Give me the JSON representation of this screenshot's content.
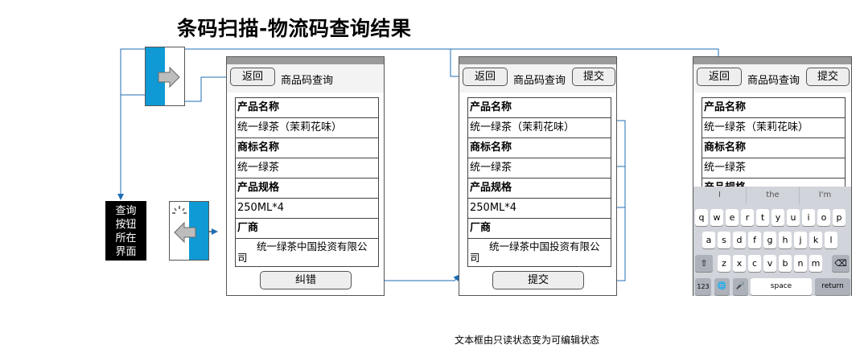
{
  "title": "条码扫描-物流码查询结果",
  "footnote": "文本框由只读状态变为可编辑状态",
  "caption_box": [
    "查询",
    "按钮",
    "所在",
    "界面"
  ],
  "phones": [
    {
      "back_label": "返回",
      "nav_title": "商品码查询",
      "submit_label": "",
      "fields": [
        {
          "label": "产品名称",
          "value": "统一绿茶（茉莉花味）"
        },
        {
          "label": "商标名称",
          "value": "统一绿茶"
        },
        {
          "label": "产品规格",
          "value": "250ML*4"
        },
        {
          "label": "厂商",
          "value_line1": "统一绿茶中国投资有限公",
          "value_line2": "司"
        }
      ],
      "bottom_button": "纠错"
    },
    {
      "back_label": "返回",
      "nav_title": "商品码查询",
      "submit_label": "提交",
      "fields": [
        {
          "label": "产品名称",
          "value": "统一绿茶（茉莉花味）"
        },
        {
          "label": "商标名称",
          "value": "统一绿茶"
        },
        {
          "label": "产品规格",
          "value": "250ML*4"
        },
        {
          "label": "厂商",
          "value_line1": "统一绿茶中国投资有限公",
          "value_line2": "司"
        }
      ],
      "bottom_button": "提交"
    },
    {
      "back_label": "返回",
      "nav_title": "商品码查询",
      "submit_label": "提交",
      "fields": [
        {
          "label": "产品名称",
          "value": "统一绿茶（茉莉花味）"
        },
        {
          "label": "商标名称",
          "value": "统一绿茶"
        },
        {
          "label": "产品规格",
          "partial": "产品规格"
        }
      ]
    }
  ],
  "keyboard": {
    "suggestions": [
      "I",
      "the",
      "I'm"
    ],
    "row1": [
      "q",
      "w",
      "e",
      "r",
      "t",
      "y",
      "u",
      "i",
      "o",
      "p"
    ],
    "row2": [
      "a",
      "s",
      "d",
      "f",
      "g",
      "h",
      "j",
      "k",
      "l"
    ],
    "row3": [
      "z",
      "x",
      "c",
      "v",
      "b",
      "n",
      "m"
    ],
    "numbers_key": "123",
    "space_key": "space",
    "return_key": "return",
    "shift_symbol": "⇧",
    "delete_symbol": "⌫",
    "globe_symbol": "🌐",
    "mic_symbol": "🎤"
  },
  "colors": {
    "accent": "#0f9ad6",
    "connector": "#1f6db3"
  }
}
